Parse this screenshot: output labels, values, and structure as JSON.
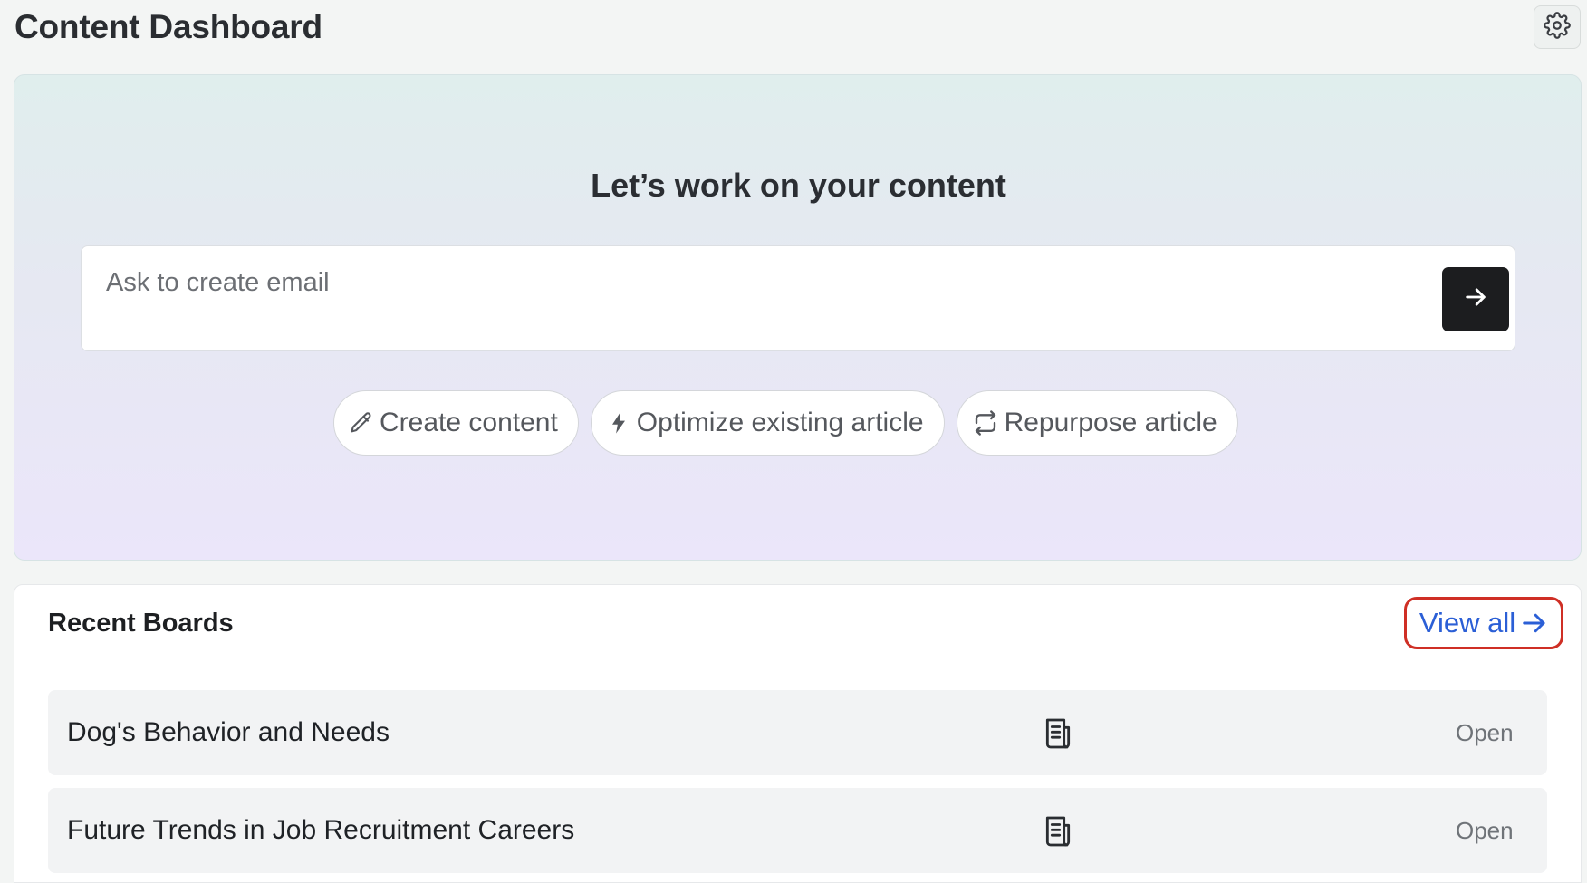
{
  "header": {
    "title": "Content Dashboard",
    "settings_icon": "gear-icon"
  },
  "hero": {
    "heading": "Let’s work on your content",
    "prompt": {
      "placeholder": "Ask to create email",
      "value": "",
      "send_icon": "arrow-right-icon"
    },
    "chips": [
      {
        "label": "Create content",
        "icon": "pencil-icon"
      },
      {
        "label": "Optimize existing article",
        "icon": "lightning-icon"
      },
      {
        "label": "Repurpose article",
        "icon": "repeat-icon"
      }
    ]
  },
  "recent_boards": {
    "title": "Recent Boards",
    "view_all_label": "View all",
    "view_all_icon": "arrow-right-icon",
    "accent_color": "#2b5fd6",
    "highlight_color": "#cf2f25",
    "items": [
      {
        "name": "Dog's Behavior and Needs",
        "icon": "document-icon",
        "action": "Open"
      },
      {
        "name": "Future Trends in Job Recruitment Careers",
        "icon": "document-icon",
        "action": "Open"
      }
    ]
  }
}
